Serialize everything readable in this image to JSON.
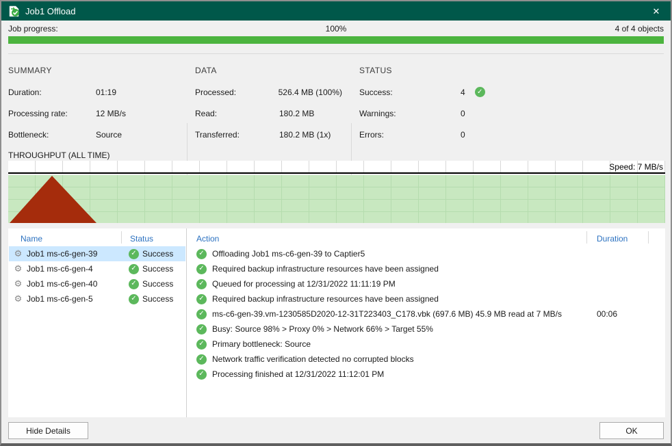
{
  "window": {
    "title": "Job1 Offload",
    "close_glyph": "✕"
  },
  "progress": {
    "label": "Job progress:",
    "percent": "100%",
    "objects": "4 of 4 objects",
    "value": 100
  },
  "summary": {
    "heading": "SUMMARY",
    "rows": [
      {
        "label": "Duration:",
        "value": "01:19"
      },
      {
        "label": "Processing rate:",
        "value": "12 MB/s"
      },
      {
        "label": "Bottleneck:",
        "value": "Source"
      }
    ]
  },
  "data_section": {
    "heading": "DATA",
    "rows": [
      {
        "label": "Processed:",
        "value": "526.4 MB (100%)"
      },
      {
        "label": "Read:",
        "value": "180.2 MB"
      },
      {
        "label": "Transferred:",
        "value": "180.2 MB (1x)"
      }
    ]
  },
  "status_section": {
    "heading": "STATUS",
    "rows": [
      {
        "label": "Success:",
        "value": "4",
        "icon": "success-badge"
      },
      {
        "label": "Warnings:",
        "value": "0"
      },
      {
        "label": "Errors:",
        "value": "0"
      }
    ],
    "badge_glyph": "✓"
  },
  "throughput": {
    "heading": "THROUGHPUT (ALL TIME)",
    "speed_label": "Speed: 7 MB/s",
    "chart": {
      "type": "area",
      "peak_speed": "7 MB/s",
      "fill_color": "#a52c0c",
      "background_color": "#c8e8c0"
    }
  },
  "table": {
    "columns": {
      "name": "Name",
      "status": "Status"
    },
    "rows": [
      {
        "name": "Job1 ms-c6-gen-39",
        "status": "Success",
        "selected": true
      },
      {
        "name": "Job1 ms-c6-gen-4",
        "status": "Success",
        "selected": false
      },
      {
        "name": "Job1 ms-c6-gen-40",
        "status": "Success",
        "selected": false
      },
      {
        "name": "Job1 ms-c6-gen-5",
        "status": "Success",
        "selected": false
      }
    ]
  },
  "log": {
    "columns": {
      "action": "Action",
      "duration": "Duration"
    },
    "items": [
      {
        "text": "Offloading Job1 ms-c6-gen-39 to Captier5",
        "duration": ""
      },
      {
        "text": "Required backup infrastructure resources have been assigned",
        "duration": ""
      },
      {
        "text": "Queued for processing at 12/31/2022 11:11:19 PM",
        "duration": ""
      },
      {
        "text": "Required backup infrastructure resources have been assigned",
        "duration": ""
      },
      {
        "text": "ms-c6-gen-39.vm-1230585D2020-12-31T223403_C178.vbk (697.6 MB) 45.9 MB read at 7 MB/s",
        "duration": "00:06"
      },
      {
        "text": "Busy: Source 98% > Proxy 0% > Network 66% > Target 55%",
        "duration": ""
      },
      {
        "text": "Primary bottleneck: Source",
        "duration": ""
      },
      {
        "text": "Network traffic verification detected no corrupted blocks",
        "duration": ""
      },
      {
        "text": "Processing finished at 12/31/2022 11:12:01 PM",
        "duration": ""
      }
    ]
  },
  "footer": {
    "hide_details": "Hide Details",
    "ok": "OK"
  },
  "colors": {
    "titlebar": "#00584a",
    "progress_fill": "#4cb43e",
    "chart_fill": "#a52c0c",
    "chart_bg": "#c8e8c0",
    "header_blue": "#2b71c0",
    "selection": "#cce8ff",
    "success_green": "#5cb85c"
  }
}
